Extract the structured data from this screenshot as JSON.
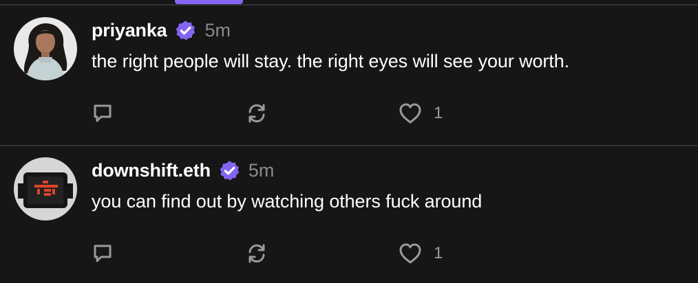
{
  "colors": {
    "background": "#161616",
    "divider": "#333335",
    "accent": "#8465f1",
    "text": "#ffffff",
    "muted": "#8a8a8e",
    "icon": "#9a9a9e"
  },
  "feed": {
    "posts": [
      {
        "username": "priyanka",
        "verified": true,
        "timestamp": "5m",
        "text": "the right people will stay. the right eyes will see your worth.",
        "avatar": "user-photo",
        "actions": {
          "reply_icon": "comment-icon",
          "recast_icon": "recast-icon",
          "like_icon": "heart-icon",
          "like_count": "1"
        }
      },
      {
        "username": "downshift.eth",
        "verified": true,
        "timestamp": "5m",
        "text": "you can find out by watching others fuck around",
        "avatar": "pixel-robot-avatar",
        "actions": {
          "reply_icon": "comment-icon",
          "recast_icon": "recast-icon",
          "like_icon": "heart-icon",
          "like_count": "1"
        }
      }
    ]
  }
}
